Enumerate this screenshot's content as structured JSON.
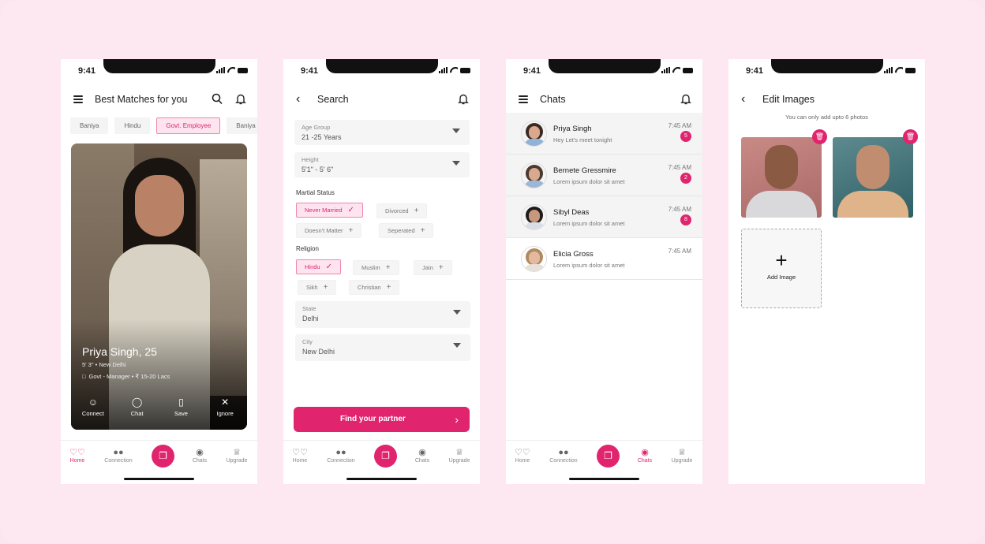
{
  "status": {
    "time": "9:41"
  },
  "colors": {
    "accent": "#e0246d",
    "background": "#fde7f0"
  },
  "nav": {
    "items": [
      "Home",
      "Connection",
      "Chats",
      "Upgrade"
    ]
  },
  "home": {
    "title": "Best Matches for you",
    "chips": [
      "Baniya",
      "Hindu",
      "Govt. Employee",
      "Baniya"
    ],
    "active_chip": "Govt. Employee",
    "profile": {
      "name": "Priya Singh, 25",
      "meta": "5' 3\" • New Delhi",
      "job": "Govt - Manager  •  ₹ 15-20 Lacs"
    },
    "actions": [
      "Connect",
      "Chat",
      "Save",
      "Ignore"
    ]
  },
  "search": {
    "title": "Search",
    "age_label": "Age Group",
    "age_value": "21 -25 Years",
    "height_label": "Height",
    "height_value": "5'1\" - 5' 6\"",
    "marital_label": "Martial Status",
    "marital": [
      "Never Married",
      "Divorced",
      "Doesn't Matter",
      "Seperated"
    ],
    "religion_label": "Religion",
    "religion": [
      "Hindu",
      "Muslim",
      "Jain",
      "Sikh",
      "Christian"
    ],
    "state_label": "State",
    "state_value": "Delhi",
    "city_label": "City",
    "city_value": "New Delhi",
    "button": "Find your partner"
  },
  "chats": {
    "title": "Chats",
    "list": [
      {
        "name": "Priya Singh",
        "msg": "Hey Let's meet tonight",
        "time": "7:45 AM",
        "badge": "5"
      },
      {
        "name": "Bernete Gressmire",
        "msg": "Lorem ipsum dolor sit amet",
        "time": "7:45 AM",
        "badge": "2"
      },
      {
        "name": "Sibyl Deas",
        "msg": "Lorem ipsum dolor sit amet",
        "time": "7:45 AM",
        "badge": "8"
      },
      {
        "name": "Elicia Gross",
        "msg": "Lorem ipsum dolor sit amet",
        "time": "7:45 AM",
        "badge": ""
      }
    ]
  },
  "edit": {
    "title": "Edit Images",
    "note": "You can only add upto 6 photos",
    "add_label": "Add Image"
  }
}
